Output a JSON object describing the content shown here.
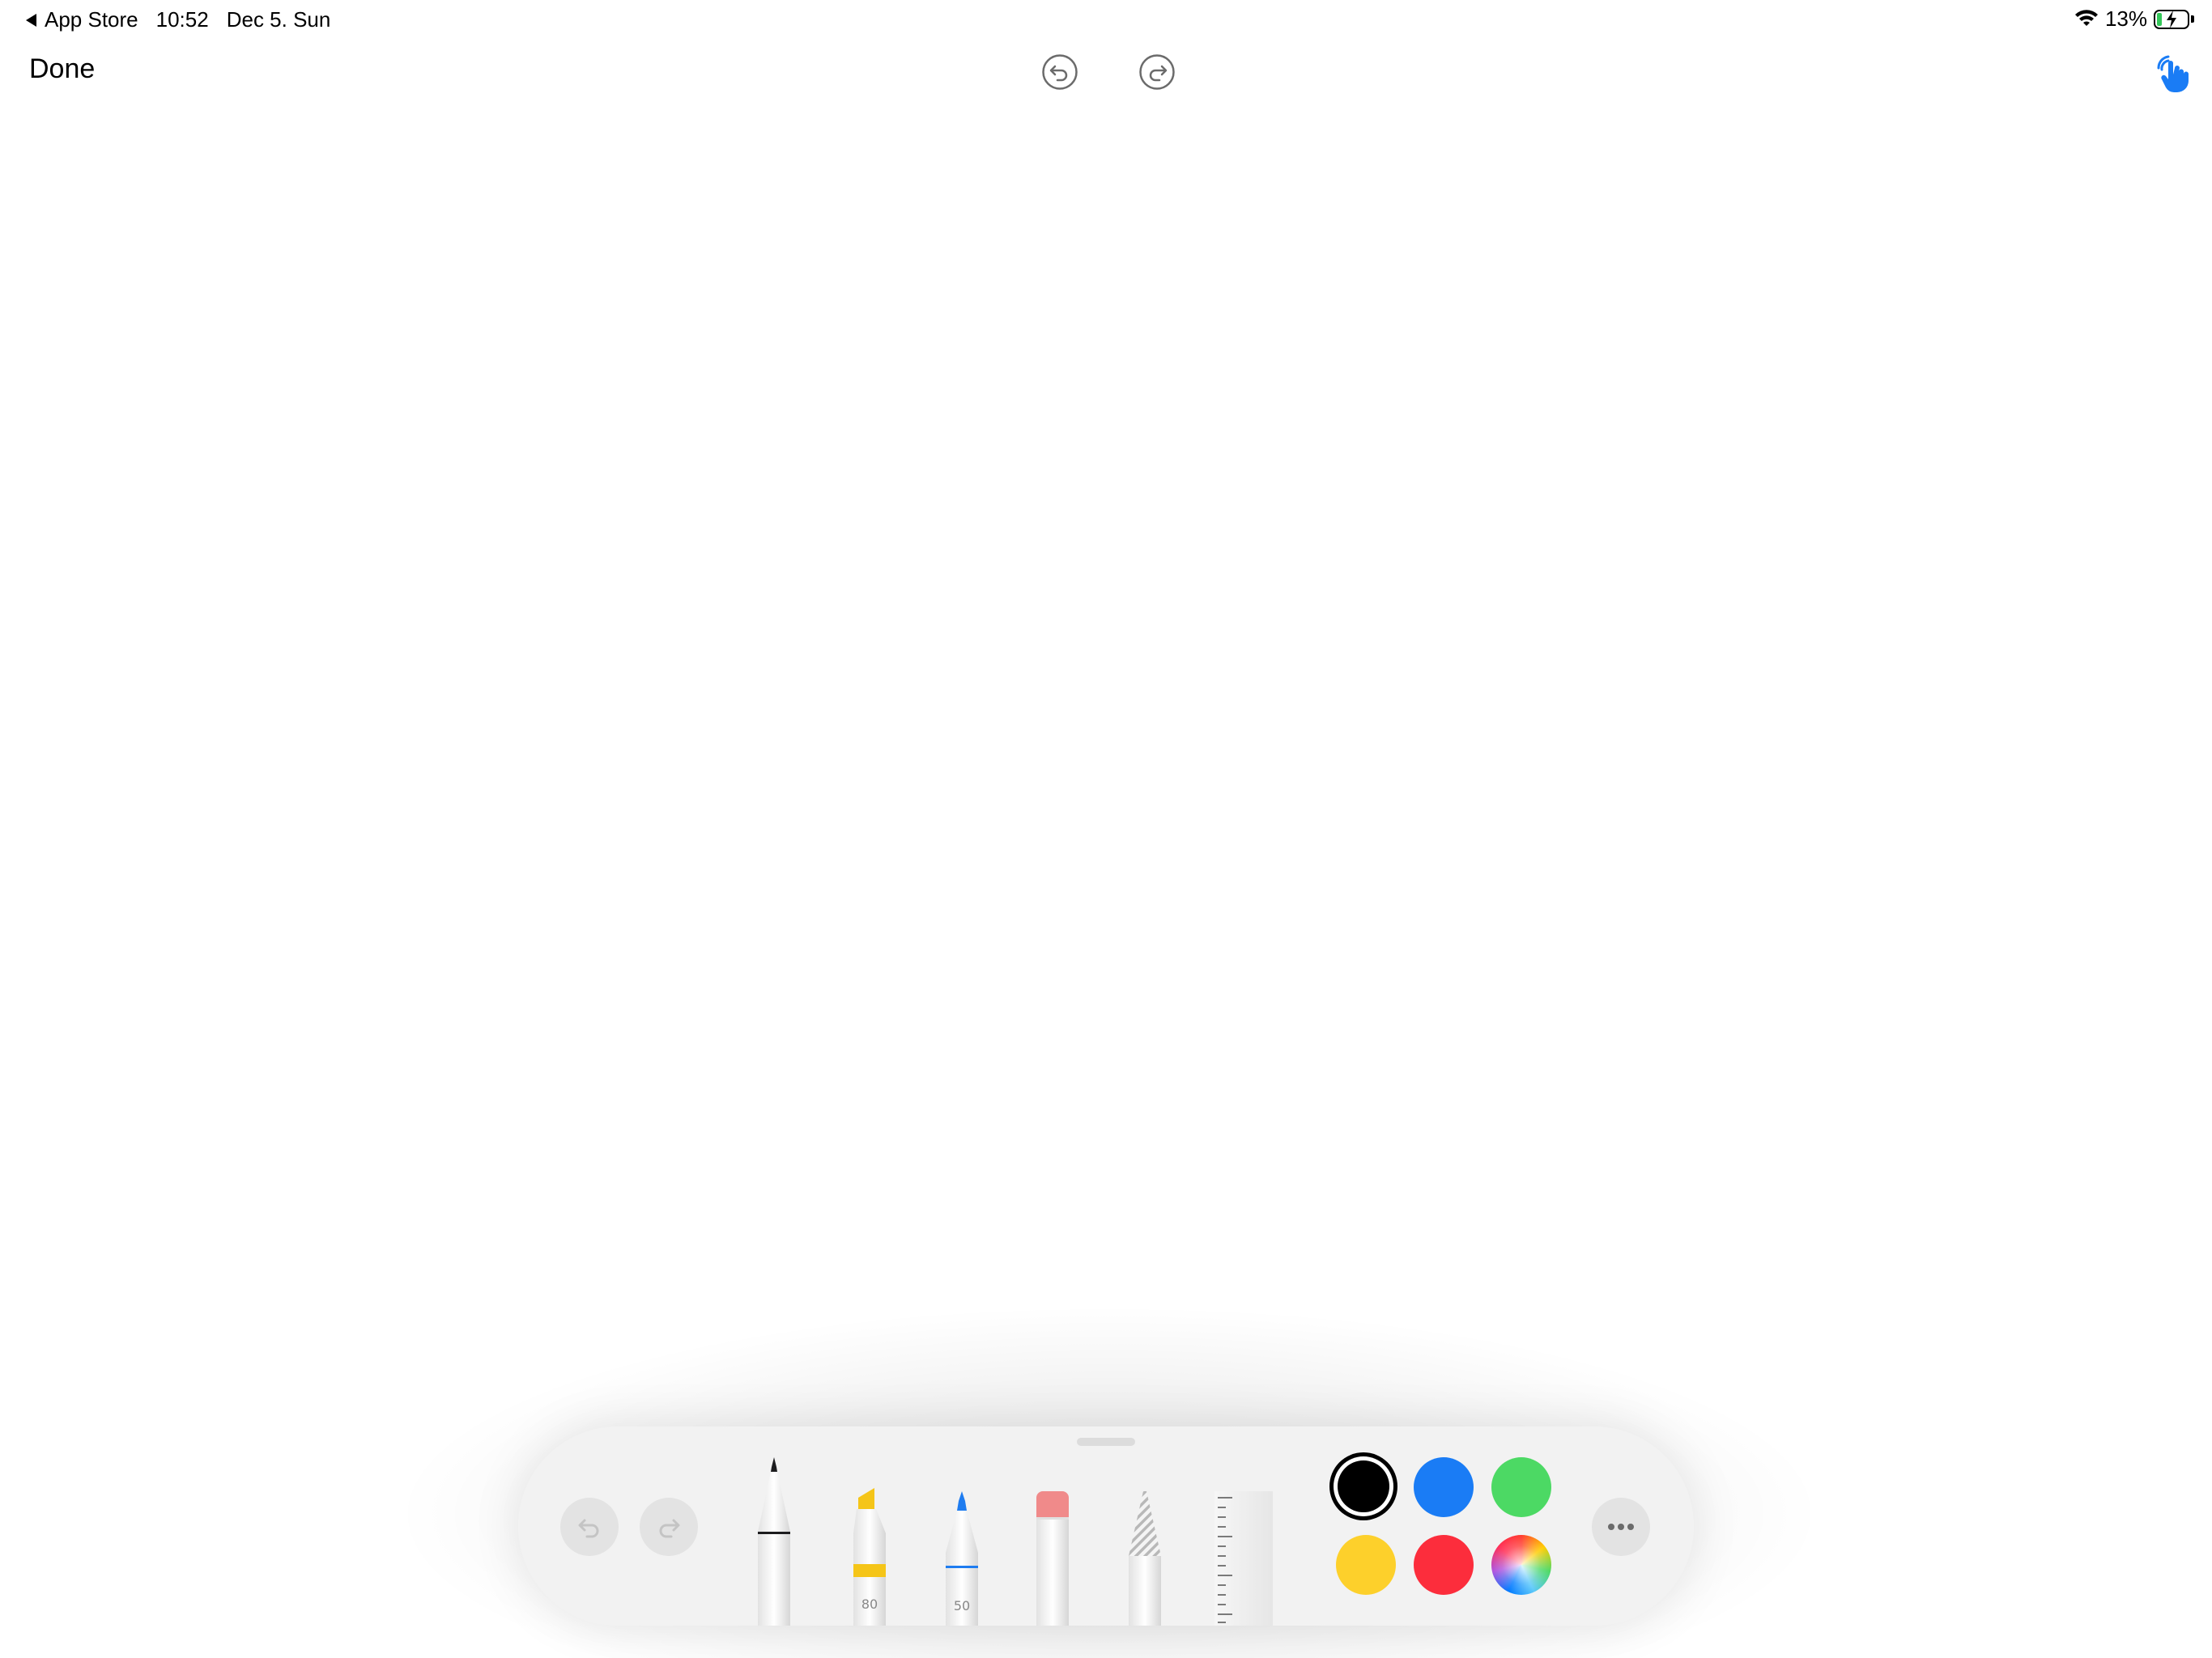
{
  "status_bar": {
    "back_app": "App Store",
    "time": "10:52",
    "date": "Dec 5. Sun",
    "battery_percent": "13%",
    "wifi_icon": "wifi-icon",
    "battery_icon": "battery-charging-icon"
  },
  "toolbar": {
    "done_label": "Done",
    "undo_icon": "undo-circle-icon",
    "redo_icon": "redo-circle-icon",
    "touch_icon": "hand-touch-icon"
  },
  "palette": {
    "tools": [
      {
        "name": "pen",
        "icon": "pen-icon",
        "tip_color": "#1c1c1e",
        "label": ""
      },
      {
        "name": "highlighter",
        "icon": "highlighter-icon",
        "tip_color": "#f5c518",
        "label": "80"
      },
      {
        "name": "pencil",
        "icon": "pencil-icon",
        "tip_color": "#1e7cf0",
        "label": "50"
      },
      {
        "name": "eraser",
        "icon": "eraser-icon",
        "tip_color": "#f08a8a",
        "label": ""
      },
      {
        "name": "lasso",
        "icon": "lasso-icon",
        "tip_color": "#b8b8b8",
        "label": ""
      },
      {
        "name": "ruler",
        "icon": "ruler-icon",
        "tip_color": "#e6e6e6",
        "label": ""
      }
    ],
    "colors": [
      {
        "name": "black",
        "hex": "#000000",
        "selected": true
      },
      {
        "name": "blue",
        "hex": "#1a7cf5",
        "selected": false
      },
      {
        "name": "green",
        "hex": "#4cd964",
        "selected": false
      },
      {
        "name": "yellow",
        "hex": "#fdd02b",
        "selected": false
      },
      {
        "name": "red",
        "hex": "#fc2d3c",
        "selected": false
      },
      {
        "name": "multicolor",
        "hex": "conic",
        "selected": false
      }
    ],
    "more_icon": "ellipsis-icon",
    "undo_icon": "undo-icon",
    "redo_icon": "redo-icon"
  },
  "colors": {
    "accent": "#1a7cf5",
    "palette_bg": "#f2f2f2"
  }
}
